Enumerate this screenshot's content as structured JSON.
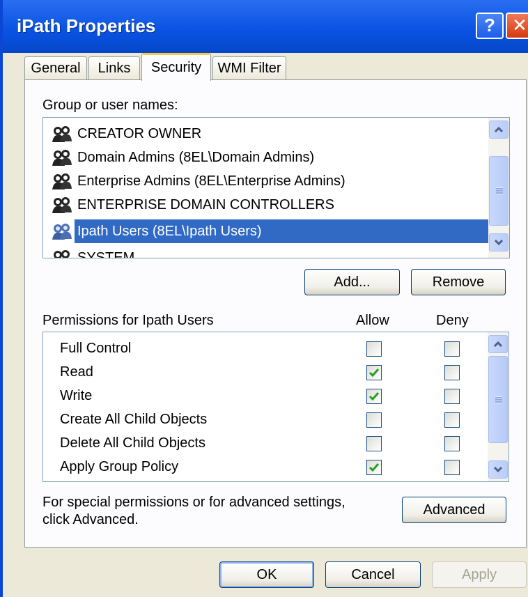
{
  "window": {
    "title": "iPath Properties",
    "help_label": "?",
    "close_label": "✕"
  },
  "tabs": [
    {
      "label": "General",
      "active": false
    },
    {
      "label": "Links",
      "active": false
    },
    {
      "label": "Security",
      "active": true
    },
    {
      "label": "WMI Filter",
      "active": false
    }
  ],
  "security": {
    "group_label": "Group or user names:",
    "groups": [
      {
        "name": "CREATOR OWNER",
        "icon": "user-group-icon",
        "selected": false
      },
      {
        "name": "Domain Admins (8EL\\Domain Admins)",
        "icon": "user-group-icon",
        "selected": false
      },
      {
        "name": "Enterprise Admins (8EL\\Enterprise Admins)",
        "icon": "user-group-icon",
        "selected": false
      },
      {
        "name": "ENTERPRISE DOMAIN CONTROLLERS",
        "icon": "user-group-icon",
        "selected": false
      },
      {
        "name": "Ipath Users (8EL\\Ipath Users)",
        "icon": "user-group-icon",
        "selected": true
      },
      {
        "name": "SYSTEM",
        "icon": "user-group-icon",
        "selected": false
      }
    ],
    "add_label": "Add...",
    "remove_label": "Remove",
    "permissions_label": "Permissions for Ipath Users",
    "allow_header": "Allow",
    "deny_header": "Deny",
    "permissions": [
      {
        "name": "Full Control",
        "allow": false,
        "deny": false
      },
      {
        "name": "Read",
        "allow": true,
        "deny": false
      },
      {
        "name": "Write",
        "allow": true,
        "deny": false
      },
      {
        "name": "Create All Child Objects",
        "allow": false,
        "deny": false
      },
      {
        "name": "Delete All Child Objects",
        "allow": false,
        "deny": false
      },
      {
        "name": "Apply Group Policy",
        "allow": true,
        "deny": false
      }
    ],
    "advanced_note_line1": "For special permissions or for advanced settings,",
    "advanced_note_line2": "click Advanced.",
    "advanced_label": "Advanced"
  },
  "footer": {
    "ok_label": "OK",
    "cancel_label": "Cancel",
    "apply_label": "Apply"
  },
  "colors": {
    "title_bar": "#0a54e4",
    "selection": "#316ac5",
    "check": "#21a121",
    "active_tab_accent": "#ffc73c"
  }
}
